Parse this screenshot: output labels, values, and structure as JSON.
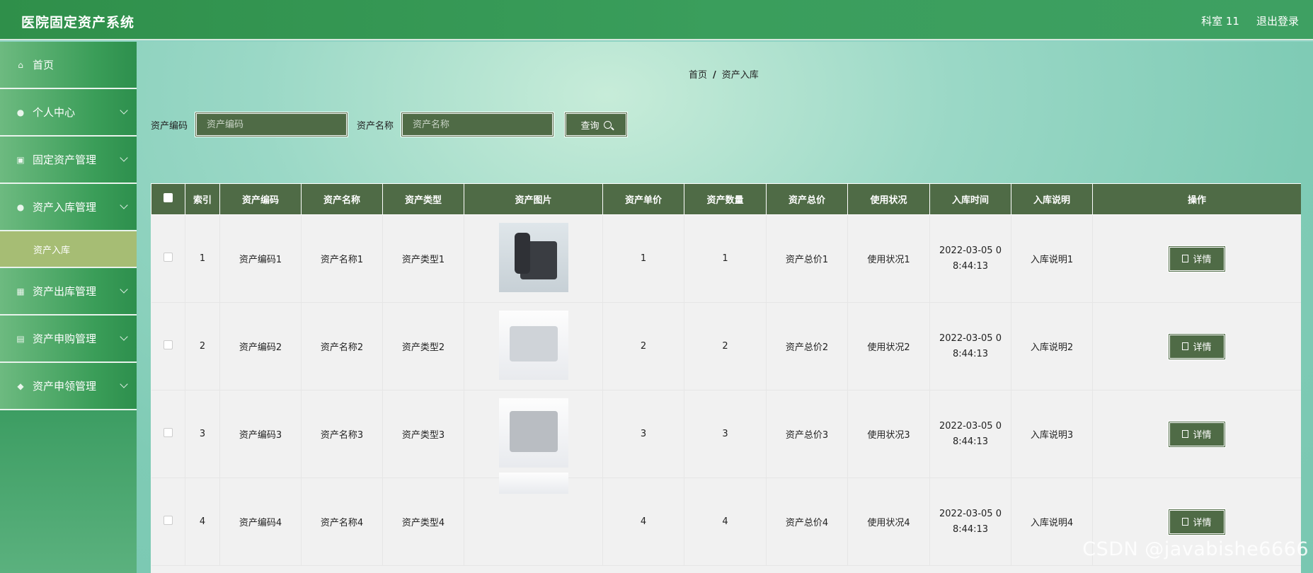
{
  "header": {
    "title": "医院固定资产系统",
    "user_label": "科室 11",
    "logout_label": "退出登录"
  },
  "sidebar": {
    "items": [
      {
        "label": "首页",
        "icon": "home-icon"
      },
      {
        "label": "个人中心",
        "icon": "user-icon"
      },
      {
        "label": "固定资产管理",
        "icon": "image-icon"
      },
      {
        "label": "资产入库管理",
        "icon": "user-icon"
      },
      {
        "label": "资产出库管理",
        "icon": "grid-icon"
      },
      {
        "label": "资产申购管理",
        "icon": "clipboard-icon"
      },
      {
        "label": "资产申领管理",
        "icon": "pin-icon"
      }
    ],
    "active_sub": "资产入库"
  },
  "breadcrumb": {
    "home": "首页",
    "sep": "/",
    "current": "资产入库"
  },
  "search": {
    "code_label": "资产编码",
    "code_placeholder": "资产编码",
    "name_label": "资产名称",
    "name_placeholder": "资产名称",
    "query_label": "查询"
  },
  "table": {
    "headers": [
      "索引",
      "资产编码",
      "资产名称",
      "资产类型",
      "资产图片",
      "资产单价",
      "资产数量",
      "资产总价",
      "使用状况",
      "入库时间",
      "入库说明",
      "操作"
    ],
    "rows": [
      {
        "index": "1",
        "code": "资产编码1",
        "name": "资产名称1",
        "type": "资产类型1",
        "image": "telephone",
        "price": "1",
        "qty": "1",
        "total": "资产总价1",
        "status": "使用状况1",
        "time1": "2022-03-05 0",
        "time2": "8:44:13",
        "note": "入库说明1",
        "action": "详情"
      },
      {
        "index": "2",
        "code": "资产编码2",
        "name": "资产名称2",
        "type": "资产类型2",
        "image": "fax-machine",
        "price": "2",
        "qty": "2",
        "total": "资产总价2",
        "status": "使用状况2",
        "time1": "2022-03-05 0",
        "time2": "8:44:13",
        "note": "入库说明2",
        "action": "详情"
      },
      {
        "index": "3",
        "code": "资产编码3",
        "name": "资产名称3",
        "type": "资产类型3",
        "image": "printer",
        "price": "3",
        "qty": "3",
        "total": "资产总价3",
        "status": "使用状况3",
        "time1": "2022-03-05 0",
        "time2": "8:44:13",
        "note": "入库说明3",
        "action": "详情"
      },
      {
        "index": "4",
        "code": "资产编码4",
        "name": "资产名称4",
        "type": "资产类型4",
        "image": "device",
        "price": "4",
        "qty": "4",
        "total": "资产总价4",
        "status": "使用状况4",
        "time1": "2022-03-05 0",
        "time2": "8:44:13",
        "note": "入库说明4",
        "action": "详情"
      }
    ]
  },
  "watermark": "CSDN @javabishe6666",
  "colors": {
    "header": "#3a9e5c",
    "table_head": "#4f6b46",
    "sub_active": "#a6bd74"
  }
}
